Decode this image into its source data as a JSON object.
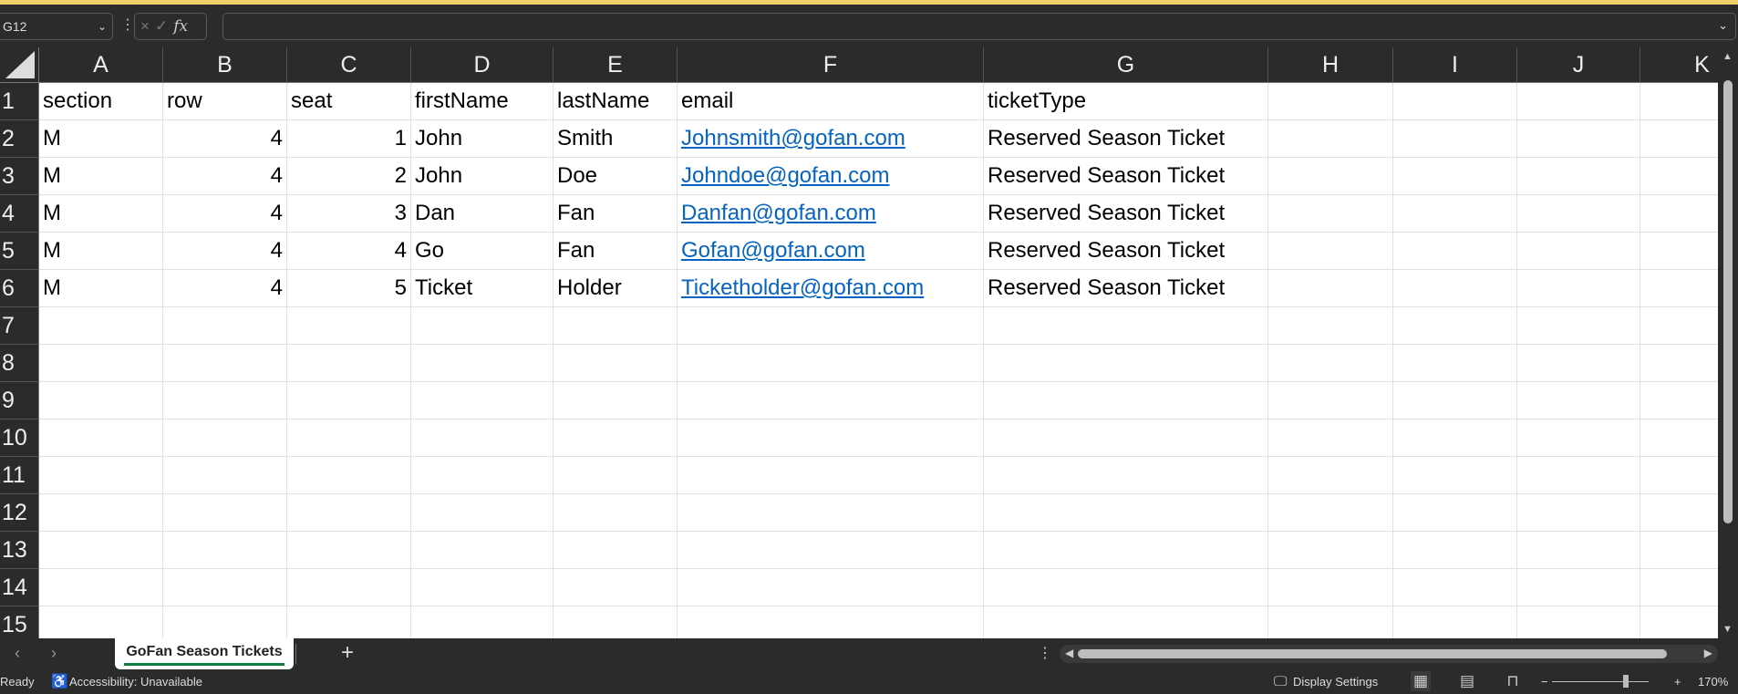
{
  "formula_bar": {
    "name_box": "G12",
    "cancel_icon": "×",
    "enter_icon": "✓",
    "fx_label": "fx",
    "formula": ""
  },
  "columns": [
    "A",
    "B",
    "C",
    "D",
    "E",
    "F",
    "G",
    "H",
    "I",
    "J",
    "K"
  ],
  "row_numbers": [
    "1",
    "2",
    "3",
    "4",
    "5",
    "6",
    "7",
    "8",
    "9",
    "10",
    "11",
    "12",
    "13",
    "14",
    "15"
  ],
  "header_row": [
    "section",
    "row",
    "seat",
    "firstName",
    "lastName",
    "email",
    "ticketType"
  ],
  "rows": [
    [
      "M",
      4,
      1,
      "John",
      "Smith",
      "Johnsmith@gofan.com",
      "Reserved Season Ticket"
    ],
    [
      "M",
      4,
      2,
      "John",
      "Doe",
      "Johndoe@gofan.com",
      "Reserved Season Ticket"
    ],
    [
      "M",
      4,
      3,
      "Dan",
      "Fan",
      "Danfan@gofan.com",
      "Reserved Season Ticket"
    ],
    [
      "M",
      4,
      4,
      "Go",
      "Fan",
      "Gofan@gofan.com",
      "Reserved Season Ticket"
    ],
    [
      "M",
      4,
      5,
      "Ticket",
      "Holder",
      "Ticketholder@gofan.com",
      "Reserved Season Ticket"
    ]
  ],
  "sheet_tabs": {
    "active": "GoFan Season Tickets",
    "add_label": "+"
  },
  "status_bar": {
    "ready": "Ready",
    "accessibility": "Accessibility: Unavailable",
    "display_settings": "Display Settings",
    "zoom": "170%",
    "zoom_level_percent": 170
  },
  "colors": {
    "link": "#0563c1",
    "tab_underline": "#107c41",
    "notification_bar": "#f2d16b"
  }
}
